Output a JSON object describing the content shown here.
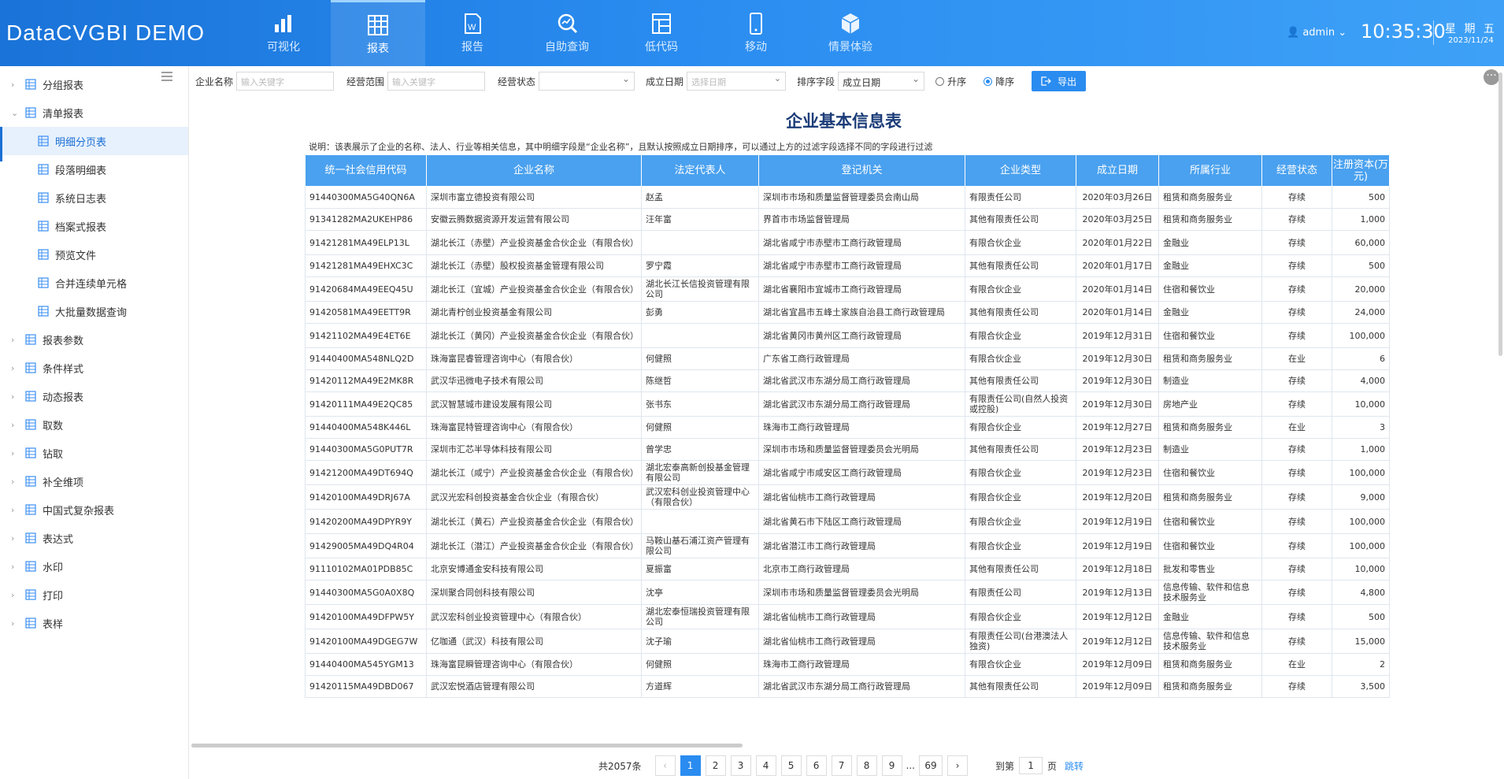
{
  "app": {
    "title": "DataCVGBI DEMO"
  },
  "nav": [
    {
      "label": "可视化",
      "icon": "bar-chart-icon"
    },
    {
      "label": "报表",
      "icon": "grid-report-icon",
      "active": true
    },
    {
      "label": "报告",
      "icon": "word-doc-icon"
    },
    {
      "label": "自助查询",
      "icon": "search-chart-icon"
    },
    {
      "label": "低代码",
      "icon": "layout-icon"
    },
    {
      "label": "移动",
      "icon": "mobile-icon"
    },
    {
      "label": "情景体验",
      "icon": "cube-icon"
    }
  ],
  "user": {
    "name": "admin"
  },
  "clock": {
    "time": "10:35:30",
    "weekday": "星 期 五",
    "date": "2023/11/24"
  },
  "sidebar": {
    "items": [
      {
        "label": "分组报表",
        "level": "top"
      },
      {
        "label": "清单报表",
        "level": "top",
        "expanded": true
      },
      {
        "label": "明细分页表",
        "level": "sub",
        "active": true
      },
      {
        "label": "段落明细表",
        "level": "sub"
      },
      {
        "label": "系统日志表",
        "level": "sub"
      },
      {
        "label": "档案式报表",
        "level": "sub"
      },
      {
        "label": "预览文件",
        "level": "sub"
      },
      {
        "label": "合并连续单元格",
        "level": "sub"
      },
      {
        "label": "大批量数据查询",
        "level": "sub"
      },
      {
        "label": "报表参数",
        "level": "top"
      },
      {
        "label": "条件样式",
        "level": "top"
      },
      {
        "label": "动态报表",
        "level": "top"
      },
      {
        "label": "取数",
        "level": "top"
      },
      {
        "label": "钻取",
        "level": "top"
      },
      {
        "label": "补全维项",
        "level": "top"
      },
      {
        "label": "中国式复杂报表",
        "level": "top"
      },
      {
        "label": "表达式",
        "level": "top"
      },
      {
        "label": "水印",
        "level": "top"
      },
      {
        "label": "打印",
        "level": "top"
      },
      {
        "label": "表样",
        "level": "top"
      }
    ]
  },
  "filters": {
    "company_label": "企业名称",
    "company_placeholder": "输入关键字",
    "scope_label": "经营范围",
    "scope_placeholder": "输入关键字",
    "status_label": "经营状态",
    "status_value": "",
    "date_label": "成立日期",
    "date_placeholder": "选择日期",
    "sort_label": "排序字段",
    "sort_value": "成立日期",
    "asc_label": "升序",
    "desc_label": "降序",
    "export_label": "导出"
  },
  "report": {
    "title": "企业基本信息表",
    "description": "说明：该表展示了企业的名称、法人、行业等相关信息，其中明细字段是“企业名称”，且默认按照成立日期排序，可以通过上方的过滤字段选择不同的字段进行过滤",
    "columns": [
      "统一社会信用代码",
      "企业名称",
      "法定代表人",
      "登记机关",
      "企业类型",
      "成立日期",
      "所属行业",
      "经营状态",
      "注册资本(万元)"
    ],
    "rows": [
      [
        "91440300MA5G40QN6A",
        "深圳市富立德投资有限公司",
        "赵孟",
        "深圳市市场和质量监督管理委员会南山局",
        "有限责任公司",
        "2020年03月26日",
        "租赁和商务服务业",
        "存续",
        "500"
      ],
      [
        "91341282MA2UKEHP86",
        "安徽云腾数据资源开发运营有限公司",
        "汪年富",
        "界首市市场监督管理局",
        "其他有限责任公司",
        "2020年03月25日",
        "租赁和商务服务业",
        "存续",
        "1,000"
      ],
      [
        "91421281MA49ELP13L",
        "湖北长江（赤壁）产业投资基金合伙企业（有限合伙）",
        "",
        "湖北省咸宁市赤壁市工商行政管理局",
        "有限合伙企业",
        "2020年01月22日",
        "金融业",
        "存续",
        "60,000"
      ],
      [
        "91421281MA49EHXC3C",
        "湖北长江（赤壁）股权投资基金管理有限公司",
        "罗宁霞",
        "湖北省咸宁市赤壁市工商行政管理局",
        "其他有限责任公司",
        "2020年01月17日",
        "金融业",
        "存续",
        "500"
      ],
      [
        "91420684MA49EEQ45U",
        "湖北长江（宜城）产业投资基金合伙企业（有限合伙）",
        "湖北长江长信投资管理有限公司",
        "湖北省襄阳市宜城市工商行政管理局",
        "有限合伙企业",
        "2020年01月14日",
        "住宿和餐饮业",
        "存续",
        "20,000"
      ],
      [
        "91420581MA49EETT9R",
        "湖北青柠创业投资基金有限公司",
        "彭勇",
        "湖北省宜昌市五峰土家族自治县工商行政管理局",
        "其他有限责任公司",
        "2020年01月14日",
        "金融业",
        "存续",
        "24,000"
      ],
      [
        "91421102MA49E4ET6E",
        "湖北长江（黄冈）产业投资基金合伙企业（有限合伙）",
        "",
        "湖北省黄冈市黄州区工商行政管理局",
        "有限合伙企业",
        "2019年12月31日",
        "住宿和餐饮业",
        "存续",
        "100,000"
      ],
      [
        "91440400MA548NLQ2D",
        "珠海富昆睿管理咨询中心（有限合伙）",
        "何健照",
        "广东省工商行政管理局",
        "有限合伙企业",
        "2019年12月30日",
        "租赁和商务服务业",
        "在业",
        "6"
      ],
      [
        "91420112MA49E2MK8R",
        "武汉华迅微电子技术有限公司",
        "陈继哲",
        "湖北省武汉市东湖分局工商行政管理局",
        "其他有限责任公司",
        "2019年12月30日",
        "制造业",
        "存续",
        "4,000"
      ],
      [
        "91420111MA49E2QC85",
        "武汉智慧城市建设发展有限公司",
        "张书东",
        "湖北省武汉市东湖分局工商行政管理局",
        "有限责任公司(自然人投资或控股)",
        "2019年12月30日",
        "房地产业",
        "存续",
        "10,000"
      ],
      [
        "91440400MA548K446L",
        "珠海富昆特管理咨询中心（有限合伙）",
        "何健照",
        "珠海市工商行政管理局",
        "有限合伙企业",
        "2019年12月27日",
        "租赁和商务服务业",
        "在业",
        "3"
      ],
      [
        "91440300MA5G0PUT7R",
        "深圳市汇芯半导体科技有限公司",
        "曾学忠",
        "深圳市市场和质量监督管理委员会光明局",
        "其他有限责任公司",
        "2019年12月23日",
        "制造业",
        "存续",
        "1,000"
      ],
      [
        "91421200MA49DT694Q",
        "湖北长江（咸宁）产业投资基金合伙企业（有限合伙）",
        "湖北宏泰高新创投基金管理有限公司",
        "湖北省咸宁市咸安区工商行政管理局",
        "有限合伙企业",
        "2019年12月23日",
        "住宿和餐饮业",
        "存续",
        "100,000"
      ],
      [
        "91420100MA49DRJ67A",
        "武汉光宏科创投资基金合伙企业（有限合伙）",
        "武汉宏科创业投资管理中心（有限合伙）",
        "湖北省仙桃市工商行政管理局",
        "有限合伙企业",
        "2019年12月20日",
        "租赁和商务服务业",
        "存续",
        "9,000"
      ],
      [
        "91420200MA49DPYR9Y",
        "湖北长江（黄石）产业投资基金合伙企业（有限合伙）",
        "",
        "湖北省黄石市下陆区工商行政管理局",
        "有限合伙企业",
        "2019年12月19日",
        "住宿和餐饮业",
        "存续",
        "100,000"
      ],
      [
        "91429005MA49DQ4R04",
        "湖北长江（潜江）产业投资基金合伙企业（有限合伙）",
        "马鞍山基石浦江资产管理有限公司",
        "湖北省潜江市工商行政管理局",
        "有限合伙企业",
        "2019年12月19日",
        "住宿和餐饮业",
        "存续",
        "100,000"
      ],
      [
        "91110102MA01PDB85C",
        "北京安博通金安科技有限公司",
        "夏振富",
        "北京市工商行政管理局",
        "其他有限责任公司",
        "2019年12月18日",
        "批发和零售业",
        "存续",
        "10,000"
      ],
      [
        "91440300MA5G0A0X8Q",
        "深圳聚合同创科技有限公司",
        "沈亭",
        "深圳市市场和质量监督管理委员会光明局",
        "有限责任公司",
        "2019年12月13日",
        "信息传输、软件和信息技术服务业",
        "存续",
        "4,800"
      ],
      [
        "91420100MA49DFPW5Y",
        "武汉宏科创业投资管理中心（有限合伙）",
        "湖北宏泰恒瑞投资管理有限公司",
        "湖北省仙桃市工商行政管理局",
        "有限合伙企业",
        "2019年12月12日",
        "金融业",
        "存续",
        "500"
      ],
      [
        "91420100MA49DGEG7W",
        "亿咖通（武汉）科技有限公司",
        "沈子瑜",
        "湖北省仙桃市工商行政管理局",
        "有限责任公司(台港澳法人独资)",
        "2019年12月12日",
        "信息传输、软件和信息技术服务业",
        "存续",
        "15,000"
      ],
      [
        "91440400MA545YGM13",
        "珠海富昆瞬管理咨询中心（有限合伙）",
        "何健照",
        "珠海市工商行政管理局",
        "有限合伙企业",
        "2019年12月09日",
        "租赁和商务服务业",
        "在业",
        "2"
      ],
      [
        "91420115MA49DBD067",
        "武汉宏悦酒店管理有限公司",
        "方道辉",
        "湖北省武汉市东湖分局工商行政管理局",
        "其他有限责任公司",
        "2019年12月09日",
        "租赁和商务服务业",
        "存续",
        "3,500"
      ]
    ]
  },
  "pagination": {
    "total": "共2057条",
    "pages": [
      "1",
      "2",
      "3",
      "4",
      "5",
      "6",
      "7",
      "8",
      "9"
    ],
    "ellipsis": "...",
    "last": "69",
    "goto_label": "到第",
    "goto_value": "1",
    "page_unit": "页",
    "jump_label": "跳转"
  }
}
